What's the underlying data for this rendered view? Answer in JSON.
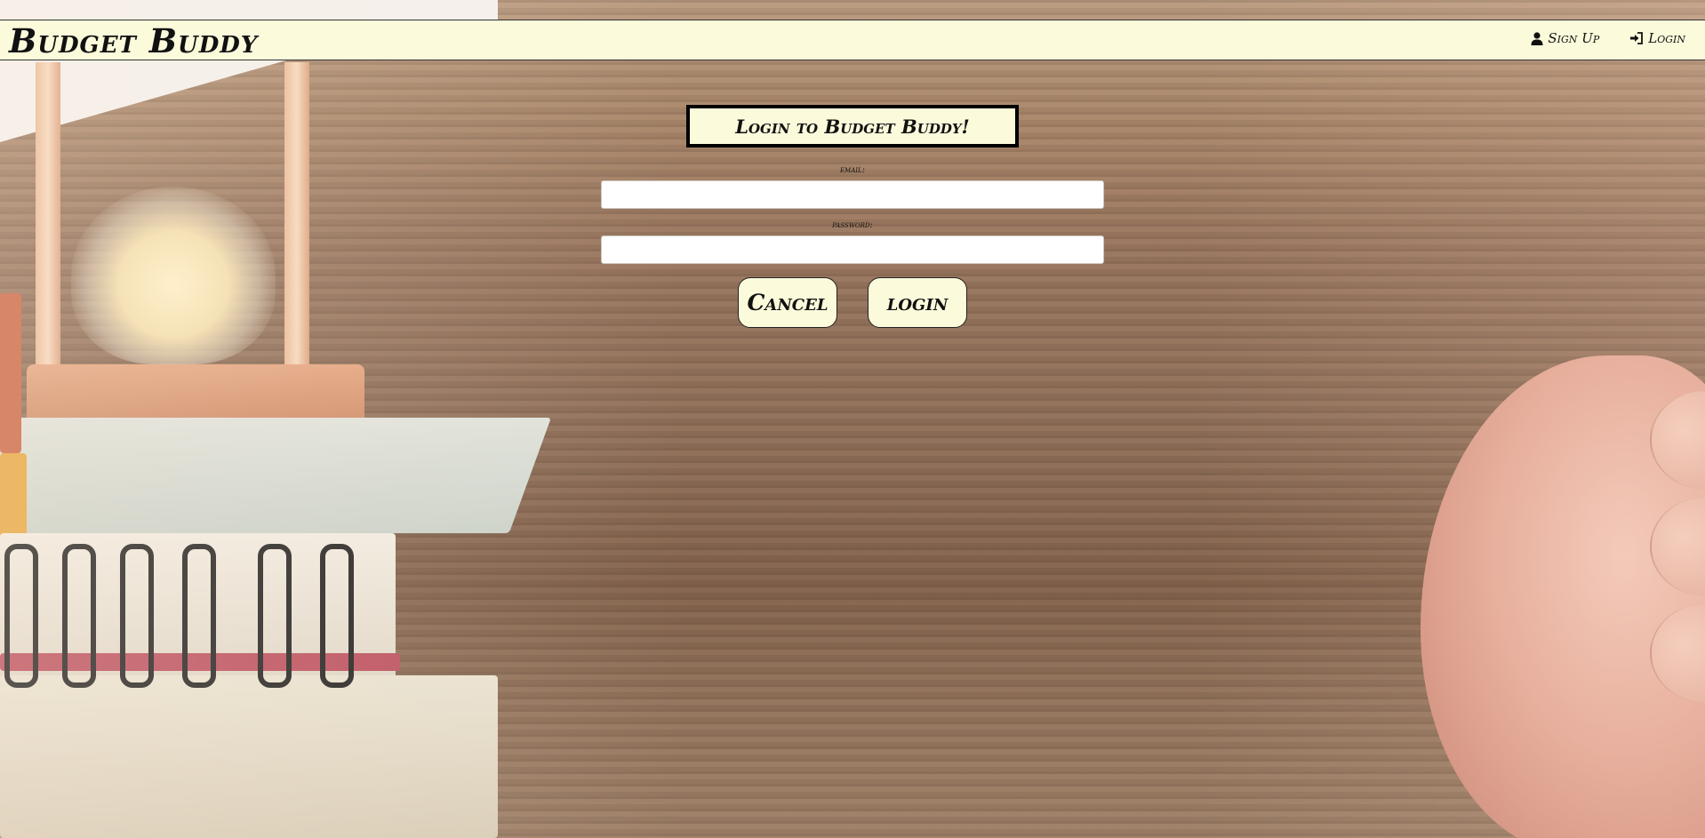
{
  "header": {
    "brand": "Budget Buddy",
    "nav": {
      "signup_label": "Sign Up",
      "signup_icon": "user-icon",
      "login_label": "Login",
      "login_icon": "sign-in-icon"
    }
  },
  "login_form": {
    "title": "Login to Budget Buddy!",
    "email_label": "email:",
    "email_value": "",
    "password_label": "password:",
    "password_value": "",
    "cancel_label": "Cancel",
    "login_label": "login"
  },
  "colors": {
    "panel_bg": "#fbfadb",
    "text": "#111111",
    "border": "#000000"
  }
}
